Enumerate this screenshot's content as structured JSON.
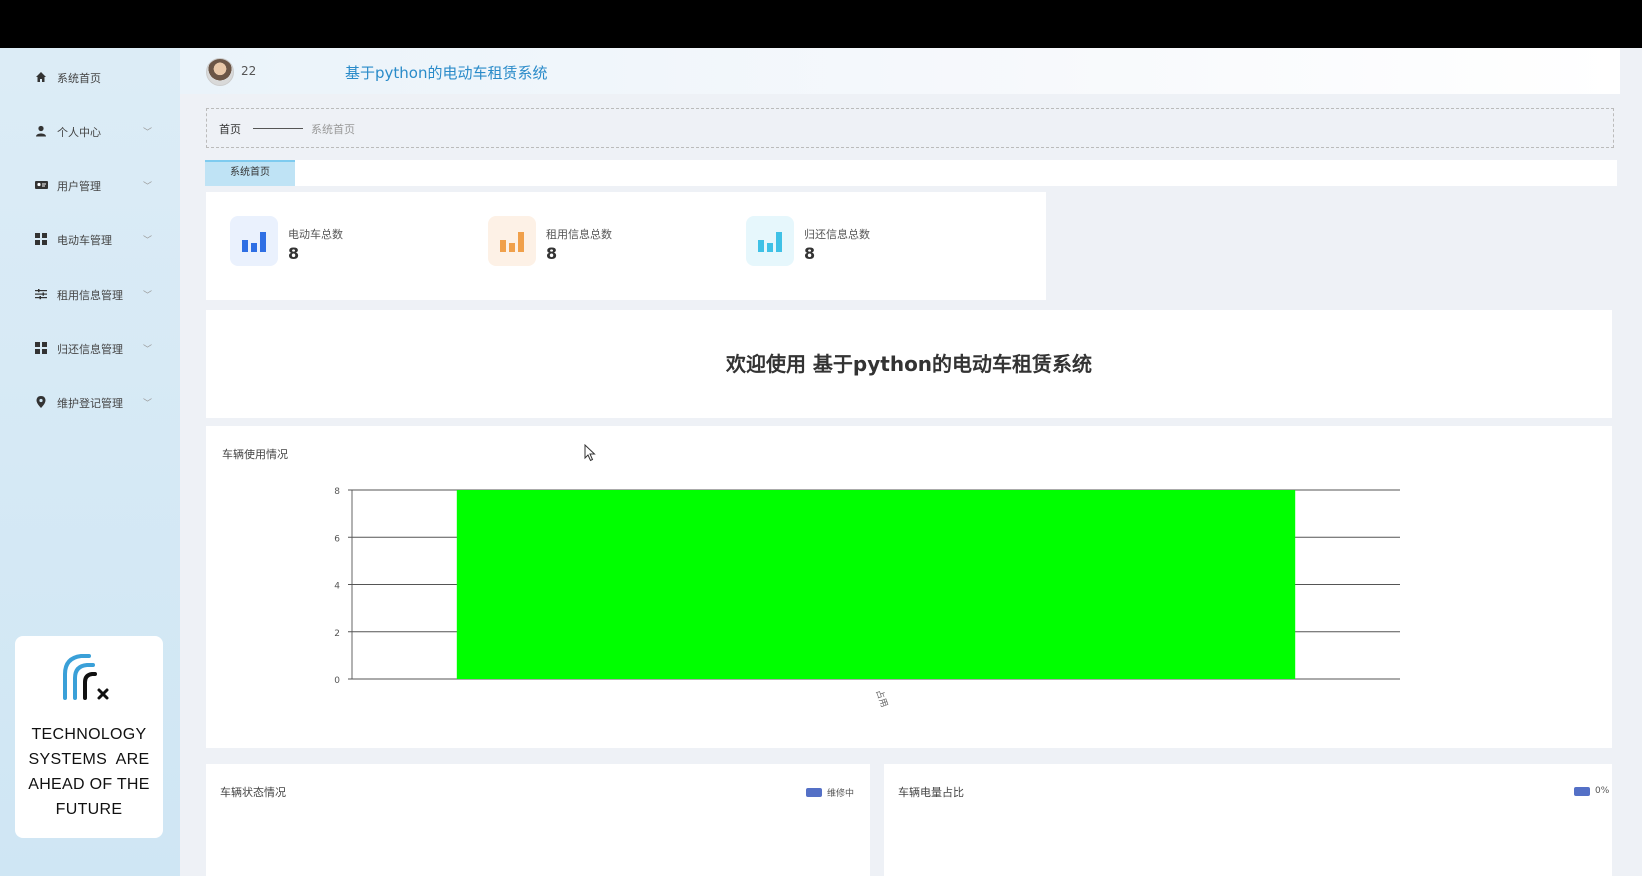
{
  "sidebar": {
    "items": [
      {
        "label": "系统首页",
        "icon": "home-icon",
        "has_chevron": false
      },
      {
        "label": "个人中心",
        "icon": "user-icon",
        "has_chevron": true
      },
      {
        "label": "用户管理",
        "icon": "users-icon",
        "has_chevron": true
      },
      {
        "label": "电动车管理",
        "icon": "grid-icon",
        "has_chevron": true
      },
      {
        "label": "租用信息管理",
        "icon": "sliders-icon",
        "has_chevron": true
      },
      {
        "label": "归还信息管理",
        "icon": "grid-icon",
        "has_chevron": true
      },
      {
        "label": "维护登记管理",
        "icon": "location-pin-icon",
        "has_chevron": true
      }
    ],
    "brand": {
      "logo": "wifi-x-logo",
      "lines": [
        "TECHNOLOGY",
        "SYSTEMS  ARE",
        "AHEAD OF THE",
        "FUTURE"
      ]
    }
  },
  "header": {
    "username": "22",
    "system_title": "基于python的电动车租赁系统"
  },
  "breadcrumb": {
    "home": "首页",
    "current": "系统首页"
  },
  "tabs": [
    {
      "label": "系统首页",
      "active": true
    }
  ],
  "stats": [
    {
      "label": "电动车总数",
      "value": "8",
      "icon": "bar-chart-icon",
      "color": "#2f6fe4",
      "bg": "#eaf1fd"
    },
    {
      "label": "租用信息总数",
      "value": "8",
      "icon": "bar-chart-icon",
      "color": "#f0a04b",
      "bg": "#fdf1e6"
    },
    {
      "label": "归还信息总数",
      "value": "8",
      "icon": "bar-chart-icon",
      "color": "#3fc1e6",
      "bg": "#e6f7fc"
    }
  ],
  "welcome": {
    "text": "欢迎使用 基于python的电动车租赁系统"
  },
  "vehicle_usage": {
    "title": "车辆使用情况"
  },
  "chart_data": {
    "type": "bar",
    "categories": [
      "占用"
    ],
    "values": [
      8
    ],
    "ylim": [
      0,
      8
    ],
    "yticks": [
      0,
      2,
      4,
      6,
      8
    ],
    "grid": true,
    "bar_color": "#00ff00"
  },
  "vehicle_status": {
    "title": "车辆状态情况",
    "legend": "维修中",
    "legend_color": "#5470c6"
  },
  "battery_ratio": {
    "title": "车辆电量占比",
    "legend": "0%",
    "legend_color": "#5470c6"
  }
}
